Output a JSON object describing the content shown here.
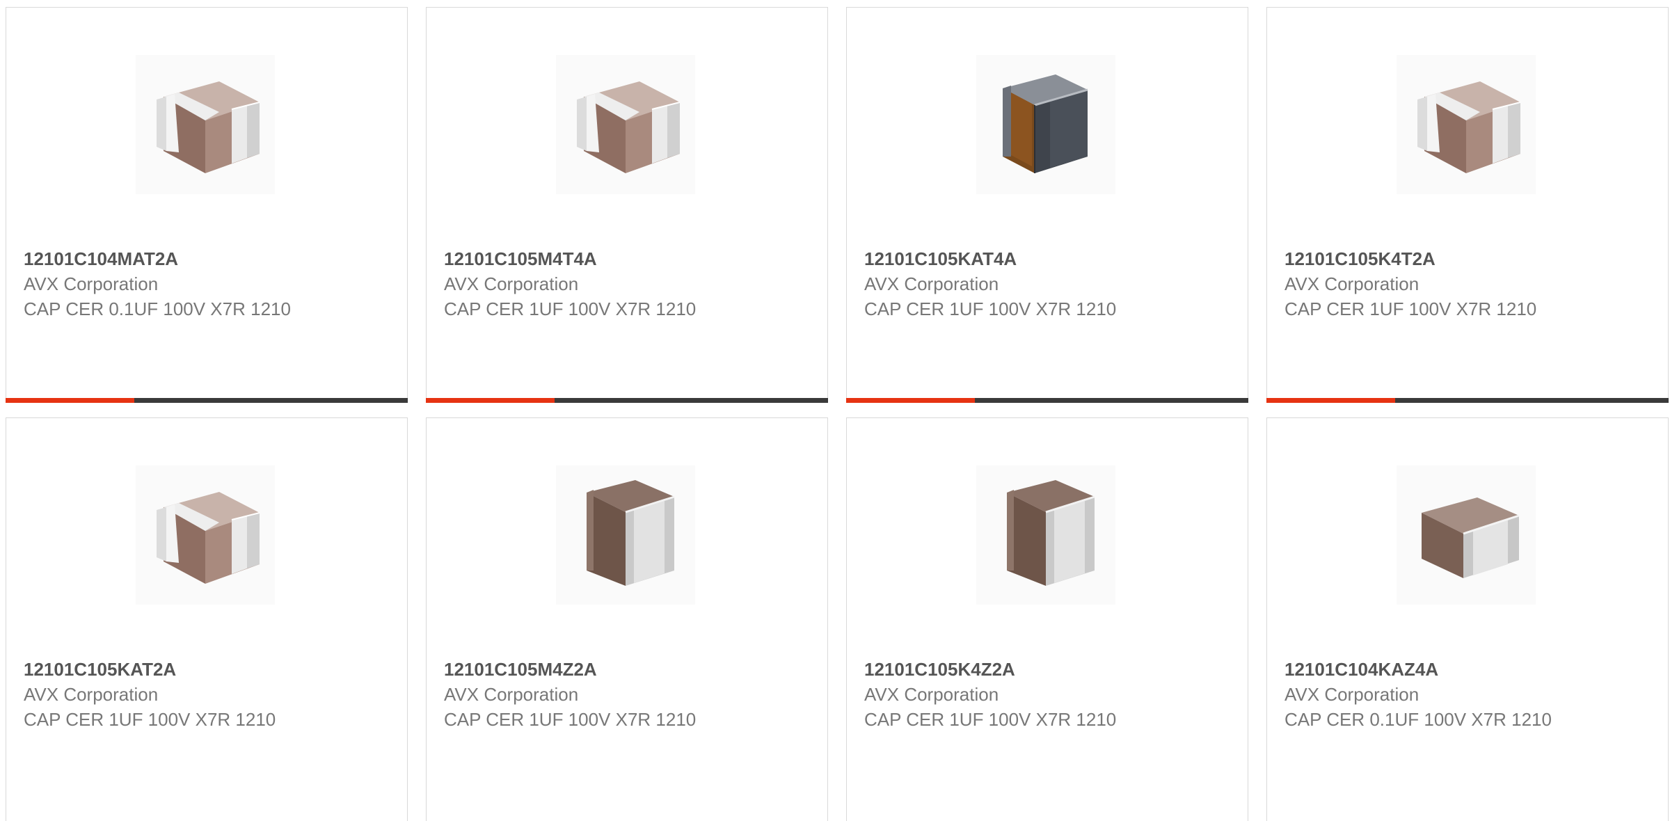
{
  "products": [
    {
      "part_number": "12101C104MAT2A",
      "manufacturer": "AVX Corporation",
      "description": "CAP CER 0.1UF 100V X7R 1210",
      "image": "ceramic-capacitor-silver-ends-icon"
    },
    {
      "part_number": "12101C105M4T4A",
      "manufacturer": "AVX Corporation",
      "description": "CAP CER 1UF 100V X7R 1210",
      "image": "ceramic-capacitor-silver-ends-icon"
    },
    {
      "part_number": "12101C105KAT4A",
      "manufacturer": "AVX Corporation",
      "description": "CAP CER 1UF 100V X7R 1210",
      "image": "ceramic-capacitor-dark-ends-icon"
    },
    {
      "part_number": "12101C105K4T2A",
      "manufacturer": "AVX Corporation",
      "description": "CAP CER 1UF 100V X7R 1210",
      "image": "ceramic-capacitor-silver-ends-icon"
    },
    {
      "part_number": "12101C105KAT2A",
      "manufacturer": "AVX Corporation",
      "description": "CAP CER 1UF 100V X7R 1210",
      "image": "ceramic-capacitor-silver-ends-icon"
    },
    {
      "part_number": "12101C105M4Z2A",
      "manufacturer": "AVX Corporation",
      "description": "CAP CER 1UF 100V X7R 1210",
      "image": "ceramic-capacitor-tall-icon"
    },
    {
      "part_number": "12101C105K4Z2A",
      "manufacturer": "AVX Corporation",
      "description": "CAP CER 1UF 100V X7R 1210",
      "image": "ceramic-capacitor-tall-icon"
    },
    {
      "part_number": "12101C104KAZ4A",
      "manufacturer": "AVX Corporation",
      "description": "CAP CER 0.1UF 100V X7R 1210",
      "image": "ceramic-capacitor-silver-ends-icon"
    }
  ],
  "colors": {
    "accent": "#e63312",
    "bar_track": "#3a3a3a",
    "part_text": "#555555",
    "body_text": "#777777",
    "card_border": "#d9d9d9"
  }
}
